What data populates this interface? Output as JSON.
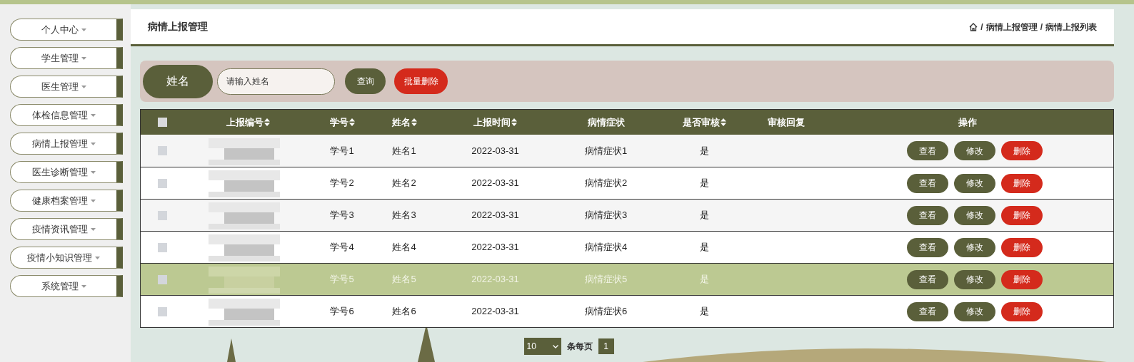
{
  "sidebar": {
    "items": [
      {
        "label": "个人中心"
      },
      {
        "label": "学生管理"
      },
      {
        "label": "医生管理"
      },
      {
        "label": "体检信息管理"
      },
      {
        "label": "病情上报管理"
      },
      {
        "label": "医生诊断管理"
      },
      {
        "label": "健康档案管理"
      },
      {
        "label": "疫情资讯管理"
      },
      {
        "label": "疫情小知识管理"
      },
      {
        "label": "系统管理"
      }
    ]
  },
  "header": {
    "title": "病情上报管理",
    "breadcrumb": [
      {
        "separator": "/",
        "label": "病情上报管理"
      },
      {
        "separator": "/",
        "label": "病情上报列表"
      }
    ]
  },
  "search": {
    "label": "姓名",
    "placeholder": "请输入姓名",
    "buttons": [
      {
        "label": "查询",
        "kind": "primary"
      },
      {
        "label": "批量删除",
        "kind": "danger"
      }
    ]
  },
  "table": {
    "select_all_checked": false,
    "columns": [
      {
        "label": "上报编号",
        "sortable": true
      },
      {
        "label": "学号",
        "sortable": true
      },
      {
        "label": "姓名",
        "sortable": true
      },
      {
        "label": "上报时间",
        "sortable": true
      },
      {
        "label": "病情症状",
        "sortable": false
      },
      {
        "label": "是否审核",
        "sortable": true
      },
      {
        "label": "审核回复",
        "sortable": false
      },
      {
        "label": "操作",
        "sortable": false
      }
    ],
    "rows": [
      {
        "checked": false,
        "selected": false,
        "cells": [
          "",
          "学号1",
          "姓名1",
          "2022-03-31",
          "病情症状1",
          "是",
          ""
        ],
        "actions": [
          "查看",
          "修改",
          "删除"
        ]
      },
      {
        "checked": false,
        "selected": false,
        "cells": [
          "",
          "学号2",
          "姓名2",
          "2022-03-31",
          "病情症状2",
          "是",
          ""
        ],
        "actions": [
          "查看",
          "修改",
          "删除"
        ]
      },
      {
        "checked": false,
        "selected": false,
        "cells": [
          "",
          "学号3",
          "姓名3",
          "2022-03-31",
          "病情症状3",
          "是",
          ""
        ],
        "actions": [
          "查看",
          "修改",
          "删除"
        ]
      },
      {
        "checked": false,
        "selected": false,
        "cells": [
          "",
          "学号4",
          "姓名4",
          "2022-03-31",
          "病情症状4",
          "是",
          ""
        ],
        "actions": [
          "查看",
          "修改",
          "删除"
        ]
      },
      {
        "checked": false,
        "selected": true,
        "cells": [
          "",
          "学号5",
          "姓名5",
          "2022-03-31",
          "病情症状5",
          "是",
          ""
        ],
        "actions": [
          "查看",
          "修改",
          "删除"
        ]
      },
      {
        "checked": false,
        "selected": false,
        "cells": [
          "",
          "学号6",
          "姓名6",
          "2022-03-31",
          "病情症状6",
          "是",
          ""
        ],
        "actions": [
          "查看",
          "修改",
          "删除"
        ]
      }
    ]
  },
  "pagination": {
    "page_size": "10",
    "per_page_label": "条每页",
    "pages": [
      {
        "label": "1",
        "selected": true
      }
    ]
  }
}
